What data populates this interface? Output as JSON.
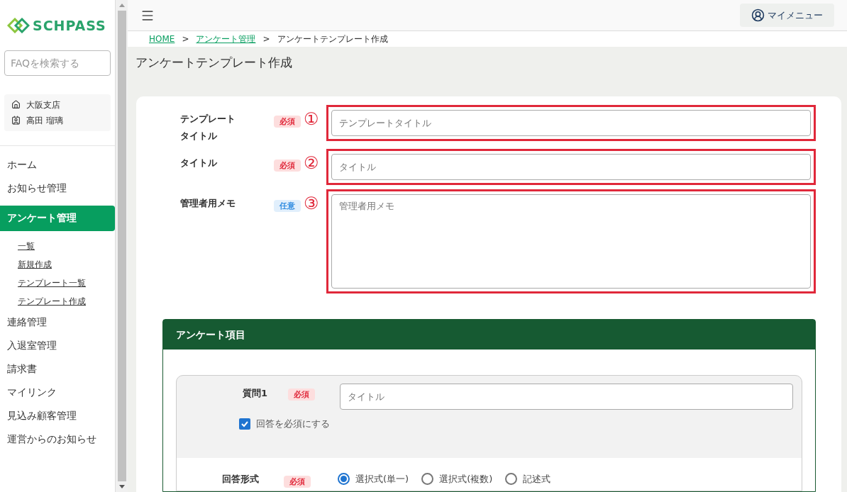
{
  "sidebar": {
    "logo": "SCHPASS",
    "search": {
      "placeholder": "FAQを検索する"
    },
    "account": [
      {
        "kind": "branch",
        "label": "大阪支店"
      },
      {
        "kind": "user",
        "label": "高田 瑠璃"
      }
    ],
    "items": [
      {
        "label": "ホーム",
        "selected": false
      },
      {
        "label": "お知らせ管理",
        "selected": false
      },
      {
        "label": "アンケート管理",
        "selected": true,
        "children": [
          {
            "label": "一覧"
          },
          {
            "label": "新規作成"
          },
          {
            "label": "テンプレート一覧"
          },
          {
            "label": "テンプレート作成"
          }
        ]
      },
      {
        "label": "連絡管理",
        "selected": false
      },
      {
        "label": "入退室管理",
        "selected": false
      },
      {
        "label": "請求書",
        "selected": false
      },
      {
        "label": "マイリンク",
        "selected": false
      },
      {
        "label": "見込み顧客管理",
        "selected": false
      },
      {
        "label": "運営からのお知らせ",
        "selected": false
      }
    ]
  },
  "header": {
    "my_menu": "マイメニュー"
  },
  "breadcrumb": [
    {
      "label": "HOME",
      "link": true
    },
    {
      "label": "アンケート管理",
      "link": true
    },
    {
      "label": "アンケートテンプレート作成",
      "link": false
    }
  ],
  "separator": ">",
  "page_title": "アンケートテンプレート作成",
  "form": [
    {
      "label": "テンプレートタイトル",
      "badge": "必須",
      "required": true,
      "marker": "①",
      "kind": "input",
      "placeholder": "テンプレートタイトル"
    },
    {
      "label": "タイトル",
      "badge": "必須",
      "required": true,
      "marker": "②",
      "kind": "input",
      "placeholder": "タイトル"
    },
    {
      "label": "管理者用メモ",
      "badge": "任意",
      "required": false,
      "marker": "③",
      "kind": "textarea",
      "placeholder": "管理者用メモ"
    }
  ],
  "survey": {
    "title": "アンケート項目",
    "question": {
      "label": "質問1",
      "badge": "必須",
      "placeholder": "タイトル",
      "checkbox": {
        "label": "回答を必須にする",
        "checked": true
      }
    },
    "answer_format": {
      "label": "回答形式",
      "badge": "必須",
      "options": [
        {
          "label": "選択式(単一)",
          "selected": true
        },
        {
          "label": "選択式(複数)",
          "selected": false
        },
        {
          "label": "記述式",
          "selected": false
        }
      ]
    }
  }
}
